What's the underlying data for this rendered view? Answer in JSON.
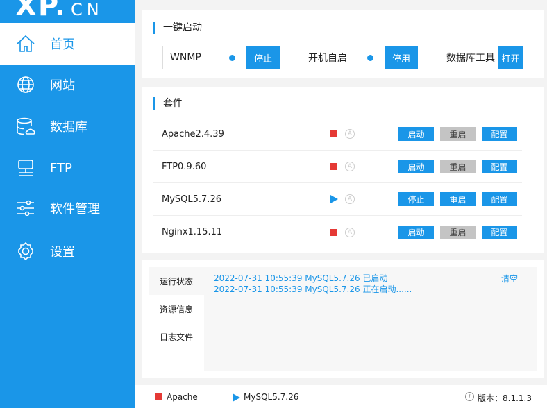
{
  "logo": {
    "text": "XP.",
    "suffix": "CN"
  },
  "sidebar": {
    "items": [
      {
        "label": "首页",
        "icon": "home-icon"
      },
      {
        "label": "网站",
        "icon": "globe-icon"
      },
      {
        "label": "数据库",
        "icon": "database-icon"
      },
      {
        "label": "FTP",
        "icon": "ftp-icon"
      },
      {
        "label": "软件管理",
        "icon": "sliders-icon"
      },
      {
        "label": "设置",
        "icon": "gear-icon"
      }
    ]
  },
  "quick_start": {
    "title": "一键启动",
    "controls": [
      {
        "label": "WNMP",
        "button": "停止"
      },
      {
        "label": "开机自启",
        "button": "停用"
      },
      {
        "label": "数据库工具",
        "button": "打开"
      }
    ]
  },
  "suite": {
    "title": "套件",
    "rows": [
      {
        "name": "Apache2.4.39",
        "status": "stopped",
        "start": "启动",
        "restart": "重启",
        "config": "配置"
      },
      {
        "name": "FTP0.9.60",
        "status": "stopped",
        "start": "启动",
        "restart": "重启",
        "config": "配置"
      },
      {
        "name": "MySQL5.7.26",
        "status": "running",
        "start": "停止",
        "restart": "重启",
        "config": "配置"
      },
      {
        "name": "Nginx1.15.11",
        "status": "stopped",
        "start": "启动",
        "restart": "重启",
        "config": "配置"
      }
    ],
    "auto_glyph": "A"
  },
  "log": {
    "tabs": [
      "运行状态",
      "资源信息",
      "日志文件"
    ],
    "lines": [
      "2022-07-31 10:55:39 MySQL5.7.26 已启动",
      "2022-07-31 10:55:39 MySQL5.7.26 正在启动......"
    ],
    "clear": "清空"
  },
  "footer": {
    "apache": "Apache",
    "mysql": "MySQL5.7.26",
    "version": "版本：8.1.1.3"
  },
  "colors": {
    "accent": "#1a96e8",
    "stopped": "#e53935",
    "disabled": "#c4c4c4"
  }
}
